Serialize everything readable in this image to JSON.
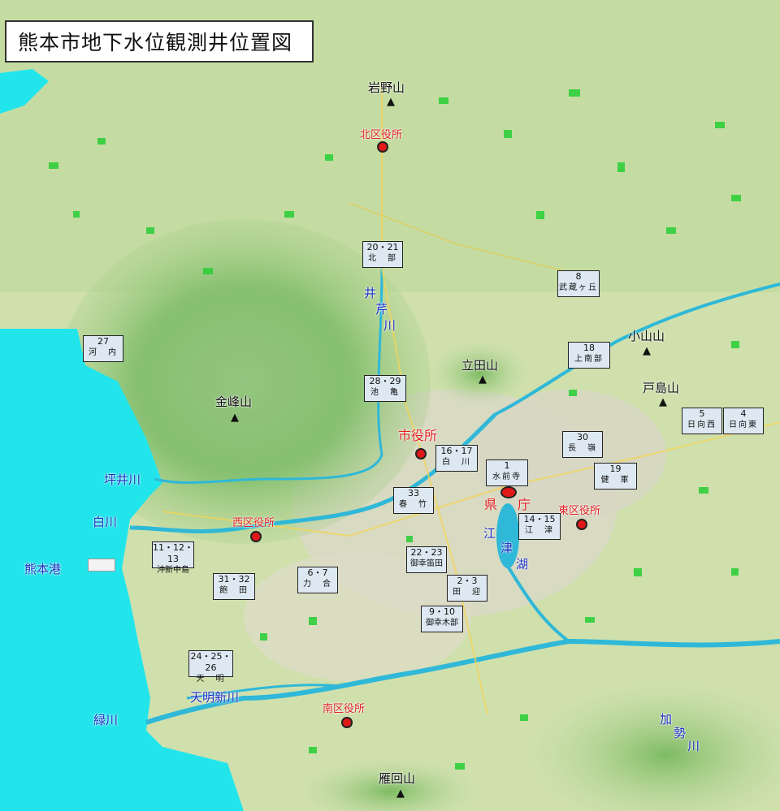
{
  "title": "熊本市地下水位観測井位置図",
  "colors": {
    "sea": "#22e5ec",
    "land": "#cfe0ad",
    "river": "#2fb8d8",
    "office": "#e01818",
    "label_river": "#1a2fc0"
  },
  "mountains": [
    "岩野山",
    "金峰山",
    "立田山",
    "小山山",
    "戸島山",
    "雁回山"
  ],
  "offices": [
    "北区役所",
    "市役所",
    "西区役所",
    "東区役所",
    "南区役所"
  ],
  "prefecture": [
    "県",
    "庁"
  ],
  "rivers": [
    "井",
    "芹",
    "川",
    "坪井川",
    "白川",
    "天明新川",
    "緑川",
    "熊本港",
    "加",
    "勢",
    "川"
  ],
  "lake": [
    "江",
    "津",
    "湖"
  ],
  "wells": [
    {
      "num": "20・21",
      "place": "北　部"
    },
    {
      "num": "8",
      "place": "武蔵ヶ丘"
    },
    {
      "num": "27",
      "place": "河　内"
    },
    {
      "num": "18",
      "place": "上南部"
    },
    {
      "num": "28・29",
      "place": "池　亀"
    },
    {
      "num": "5",
      "place": "日向西"
    },
    {
      "num": "4",
      "place": "日向東"
    },
    {
      "num": "30",
      "place": "長　嶺"
    },
    {
      "num": "16・17",
      "place": "白　川"
    },
    {
      "num": "1",
      "place": "水前寺"
    },
    {
      "num": "19",
      "place": "健　軍"
    },
    {
      "num": "33",
      "place": "春　竹"
    },
    {
      "num": "14・15",
      "place": "江　津"
    },
    {
      "num": "11・12・13",
      "place": "沖新中島"
    },
    {
      "num": "22・23",
      "place": "御幸笛田"
    },
    {
      "num": "31・32",
      "place": "飽　田"
    },
    {
      "num": "6・7",
      "place": "力　合"
    },
    {
      "num": "2・3",
      "place": "田　迎"
    },
    {
      "num": "9・10",
      "place": "御幸木部"
    },
    {
      "num": "24・25・26",
      "place": "天　明"
    }
  ]
}
